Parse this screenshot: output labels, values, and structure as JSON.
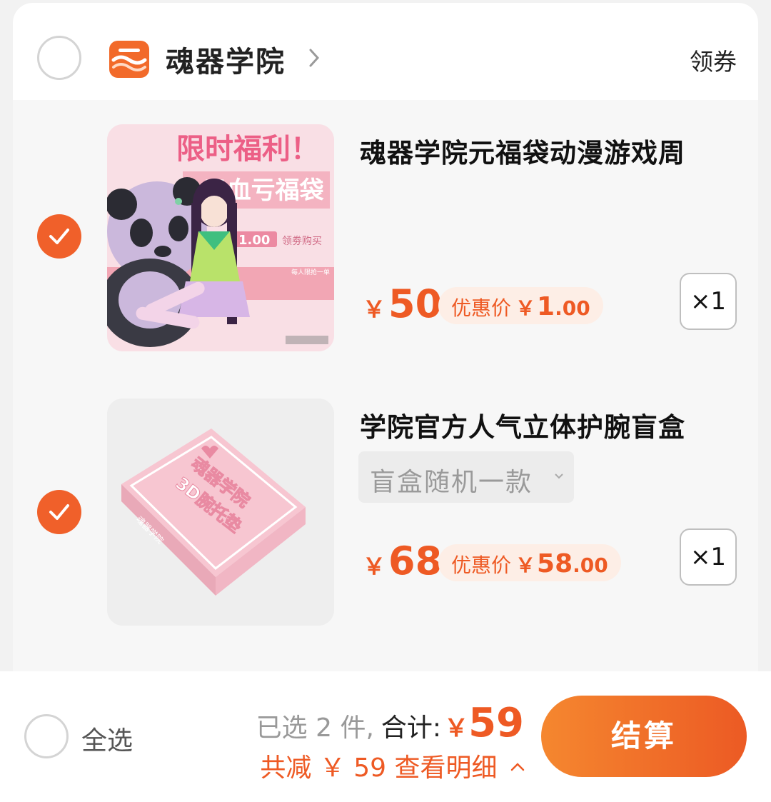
{
  "shop": {
    "name": "魂器学院",
    "coupon_label": "领券",
    "selected": false
  },
  "items": [
    {
      "title": "魂器学院元福袋动漫游戏周",
      "selected": true,
      "image": {
        "icon": "lucky-bag-panda-anime-girl",
        "text_line1": "限时福利！",
        "text_line2": "1元血亏福袋",
        "price_tag": "￥1.00",
        "tag_note": "领劵购买",
        "sub_note": "每人限抢一单"
      },
      "price_currency": "￥",
      "price": "50",
      "promo_label": "优惠价",
      "promo_currency": "￥",
      "promo_int": "1",
      "promo_dec": ".00",
      "quantity": "×1"
    },
    {
      "title": "学院官方人气立体护腕盲盒",
      "selected": true,
      "variant": "盲盒随机一款",
      "image": {
        "icon": "blind-box-pink",
        "box_text_line1": "魂器学院",
        "box_text_line2": "3D腕托垫",
        "side_text": "魂器学院"
      },
      "price_currency": "￥",
      "price": "68",
      "promo_label": "优惠价",
      "promo_currency": "￥",
      "promo_int": "58",
      "promo_dec": ".00",
      "quantity": "×1"
    }
  ],
  "footer": {
    "select_all_label": "全选",
    "selected_count_text": "已选 2 件,",
    "total_label": "合计:",
    "total_currency": "￥",
    "total_amount": "59",
    "savings_text": "共减 ￥ 59",
    "details_label": "查看明细",
    "checkout_label": "结算"
  },
  "colors": {
    "accent": "#ee5a24",
    "promo_bg": "#fdeee6",
    "checkout_gradient_start": "#f5872f",
    "checkout_gradient_end": "#ec5a24"
  }
}
